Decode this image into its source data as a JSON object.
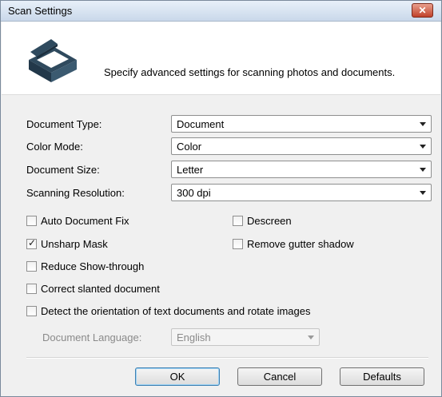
{
  "window": {
    "title": "Scan Settings",
    "close_label": "✕"
  },
  "header": {
    "description": "Specify advanced settings for scanning photos and documents."
  },
  "form": {
    "rows": [
      {
        "label": "Document Type:",
        "value": "Document"
      },
      {
        "label": "Color Mode:",
        "value": "Color"
      },
      {
        "label": "Document Size:",
        "value": "Letter"
      },
      {
        "label": "Scanning Resolution:",
        "value": "300 dpi"
      }
    ]
  },
  "options": {
    "auto_document_fix": {
      "label": "Auto Document Fix",
      "checked": false
    },
    "descreen": {
      "label": "Descreen",
      "checked": false
    },
    "unsharp_mask": {
      "label": "Unsharp Mask",
      "checked": true
    },
    "remove_gutter_shadow": {
      "label": "Remove gutter shadow",
      "checked": false
    },
    "reduce_show_through": {
      "label": "Reduce Show-through",
      "checked": false
    },
    "correct_slanted": {
      "label": "Correct slanted document",
      "checked": false
    },
    "detect_orientation": {
      "label": "Detect the orientation of text documents and rotate images",
      "checked": false
    }
  },
  "language": {
    "label": "Document Language:",
    "value": "English",
    "disabled": true
  },
  "buttons": {
    "ok": "OK",
    "cancel": "Cancel",
    "defaults": "Defaults"
  }
}
